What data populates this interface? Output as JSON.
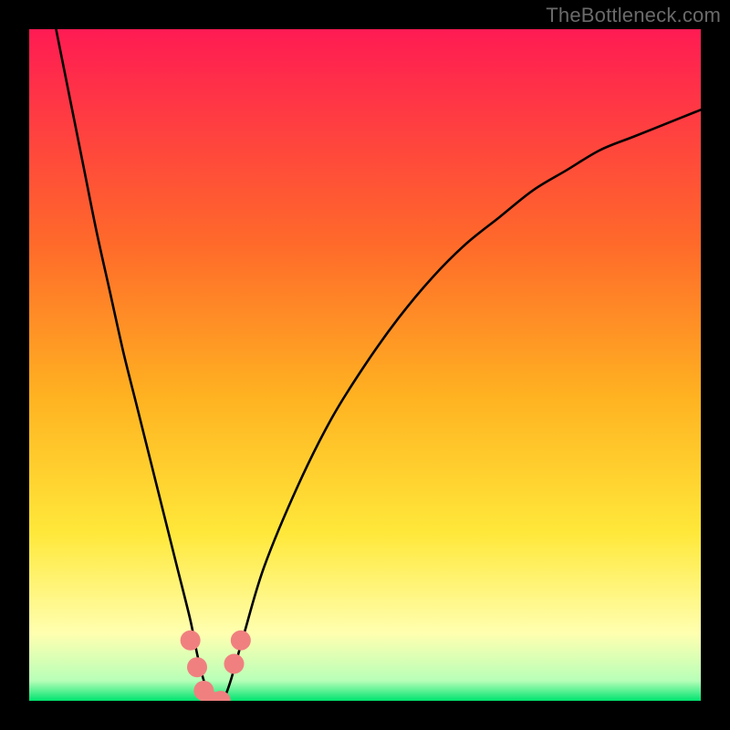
{
  "watermark": "TheBottleneck.com",
  "gradient_colors": {
    "top": "#ff1b53",
    "mid1": "#ff6a2a",
    "mid2": "#ffb321",
    "mid3": "#ffe83a",
    "pale": "#ffffb0",
    "green": "#00e36f"
  },
  "chart_data": {
    "type": "line",
    "title": "",
    "xlabel": "",
    "ylabel": "",
    "xlim": [
      0,
      100
    ],
    "ylim": [
      0,
      100
    ],
    "series": [
      {
        "name": "bottleneck-curve",
        "x": [
          4,
          6,
          8,
          10,
          12,
          14,
          16,
          18,
          20,
          22,
          24,
          25,
          26,
          27,
          28,
          29,
          30,
          32,
          35,
          40,
          45,
          50,
          55,
          60,
          65,
          70,
          75,
          80,
          85,
          90,
          95,
          100
        ],
        "y": [
          100,
          90,
          80,
          70,
          61,
          52,
          44,
          36,
          28,
          20,
          12,
          7,
          3,
          0.5,
          0,
          0.5,
          3,
          10,
          20,
          32,
          42,
          50,
          57,
          63,
          68,
          72,
          76,
          79,
          82,
          84,
          86,
          88
        ]
      }
    ],
    "markers": [
      {
        "name": "marker-a",
        "x": 24.0,
        "y": 9.0
      },
      {
        "name": "marker-b",
        "x": 25.0,
        "y": 5.0
      },
      {
        "name": "marker-c",
        "x": 26.0,
        "y": 1.5
      },
      {
        "name": "marker-d",
        "x": 27.0,
        "y": 0.0
      },
      {
        "name": "marker-e",
        "x": 28.5,
        "y": 0.0
      },
      {
        "name": "marker-f",
        "x": 30.5,
        "y": 5.5
      },
      {
        "name": "marker-g",
        "x": 31.5,
        "y": 9.0
      }
    ],
    "marker_color": "#f08080",
    "curve_color": "#000000"
  }
}
